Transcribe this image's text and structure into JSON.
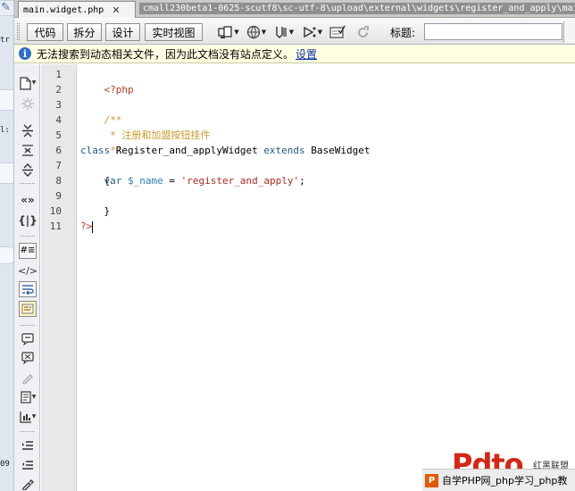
{
  "background_app": {
    "fragments": [
      "tr",
      "l:",
      "09"
    ]
  },
  "tabs": {
    "active_label": "main.widget.php",
    "close_glyph": "✕",
    "file_path": "cmall230beta1-0625-scutf8\\sc-utf-8\\upload\\external\\widgets\\register_and_apply\\main.w"
  },
  "toolbar": {
    "view_buttons": [
      "代码",
      "拆分",
      "设计",
      "实时视图"
    ],
    "icons": [
      "multiscreen-icon",
      "preview-globe-icon",
      "debug-icon",
      "visual-aids-icon",
      "validate-icon",
      "refresh-icon"
    ],
    "title_label": "标题:",
    "title_value": ""
  },
  "infobar": {
    "icon": "i",
    "message": "无法搜索到动态相关文件，因为此文档没有站点定义。",
    "link": "设置"
  },
  "sidebar": {
    "icons": [
      "open-documents-icon",
      "show-code-navigator-icon",
      "collapse-full-tag-icon",
      "collapse-selection-icon",
      "expand-all-icon",
      "select-parent-tag-icon",
      "balance-braces-icon",
      "line-numbers-icon",
      "highlight-invalid-code-icon",
      "word-wrap-icon",
      "syntax-coloring-icon",
      "apply-comment-icon",
      "remove-comment-icon",
      "wrap-tag-icon",
      "recent-snippets-icon",
      "move-css-icon",
      "indent-code-icon",
      "outdent-code-icon",
      "format-source-icon"
    ]
  },
  "editor": {
    "line_numbers": [
      "1",
      "2",
      "3",
      "4",
      "5",
      "6",
      "7",
      "8",
      "9",
      "10",
      "11"
    ],
    "line1": {
      "open_tag": "<?php"
    },
    "line3": {
      "comment": "/**"
    },
    "line4": {
      "comment": " * 注册和加盟按钮挂件"
    },
    "line5": {
      "comment": " */"
    },
    "line6": {
      "kw_class": "class",
      "class_name": " Register_and_applyWidget ",
      "kw_extends": "extends",
      "parent": " BaseWidget"
    },
    "line7": {
      "brace": "{"
    },
    "line8": {
      "indent": "    ",
      "kw_var": "var",
      "sp": " ",
      "var_name": "$_name",
      "assign": " = ",
      "value": "'register_and_apply'",
      "end": ";"
    },
    "line9": {
      "brace": "}"
    },
    "line11": {
      "close_tag": "?>"
    }
  },
  "watermark": {
    "logo_text": "Pdto",
    "brand": "红黑联盟",
    "badge": "P",
    "caption": "自学PHP网_php学习_php教"
  },
  "colors": {
    "php_tag": "#c0391e",
    "comment": "#cc9a2b",
    "keyword": "#205a86",
    "variable": "#2a80b8",
    "string": "#b0281f",
    "infobar_bg": "#ffffe1",
    "link": "#0b2fa8"
  }
}
